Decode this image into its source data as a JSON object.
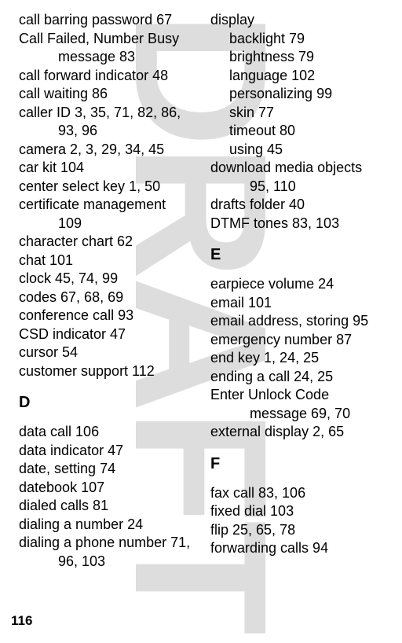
{
  "watermark": "DRAFT",
  "page_number": "116",
  "left_column": {
    "entries": [
      {
        "text": "call barring password  67",
        "indent": false
      },
      {
        "text": "Call Failed, Number Busy ",
        "indent": false
      },
      {
        "text": "message  83",
        "indent": true
      },
      {
        "text": "call forward indicator  48",
        "indent": false
      },
      {
        "text": "call waiting  86",
        "indent": false
      },
      {
        "text": "caller ID  3, 35, 71, 82, 86, ",
        "indent": false
      },
      {
        "text": "93, 96",
        "indent": true
      },
      {
        "text": "camera  2, 3, 29, 34, 45",
        "indent": false
      },
      {
        "text": "car kit  104",
        "indent": false
      },
      {
        "text": "center select key  1, 50",
        "indent": false
      },
      {
        "text": "certificate management  ",
        "indent": false
      },
      {
        "text": "109",
        "indent": true
      },
      {
        "text": "character chart  62",
        "indent": false
      },
      {
        "text": "chat  101",
        "indent": false
      },
      {
        "text": "clock  45, 74, 99",
        "indent": false
      },
      {
        "text": "codes  67, 68, 69",
        "indent": false
      },
      {
        "text": "conference call  93",
        "indent": false
      },
      {
        "text": "CSD indicator  47",
        "indent": false
      },
      {
        "text": "cursor  54",
        "indent": false
      },
      {
        "text": "customer support  112",
        "indent": false
      }
    ],
    "section_d": {
      "heading": "D",
      "entries": [
        {
          "text": "data call  106",
          "indent": false
        },
        {
          "text": "data indicator  47",
          "indent": false
        },
        {
          "text": "date, setting  74",
          "indent": false
        },
        {
          "text": "datebook  107",
          "indent": false
        },
        {
          "text": "dialed calls  81",
          "indent": false
        },
        {
          "text": "dialing a number  24",
          "indent": false
        },
        {
          "text": "dialing a phone number  71, ",
          "indent": false
        },
        {
          "text": "96, 103",
          "indent": true
        }
      ]
    }
  },
  "right_column": {
    "entries": [
      {
        "text": "display",
        "indent": false
      },
      {
        "text": "backlight  79",
        "indent": false,
        "sub": true
      },
      {
        "text": "brightness  79",
        "indent": false,
        "sub": true
      },
      {
        "text": "language  102",
        "indent": false,
        "sub": true
      },
      {
        "text": "personalizing  99",
        "indent": false,
        "sub": true
      },
      {
        "text": "skin  77",
        "indent": false,
        "sub": true
      },
      {
        "text": "timeout  80",
        "indent": false,
        "sub": true
      },
      {
        "text": "using  45",
        "indent": false,
        "sub": true
      },
      {
        "text": "download media objects  ",
        "indent": false
      },
      {
        "text": "95, 110",
        "indent": true
      },
      {
        "text": "drafts folder  40",
        "indent": false
      },
      {
        "text": "DTMF tones  83, 103",
        "indent": false
      }
    ],
    "section_e": {
      "heading": "E",
      "entries": [
        {
          "text": "earpiece volume  24",
          "indent": false
        },
        {
          "text": "email  101",
          "indent": false
        },
        {
          "text": "email address, storing  95",
          "indent": false
        },
        {
          "text": "emergency number  87",
          "indent": false
        },
        {
          "text": "end key  1, 24, 25",
          "indent": false
        },
        {
          "text": "ending a call  24, 25",
          "indent": false
        },
        {
          "text": "Enter Unlock Code ",
          "indent": false
        },
        {
          "text": "message  69, 70",
          "indent": true
        },
        {
          "text": "external display  2, 65",
          "indent": false
        }
      ]
    },
    "section_f": {
      "heading": "F",
      "entries": [
        {
          "text": "fax call  83, 106",
          "indent": false
        },
        {
          "text": "fixed dial  103",
          "indent": false
        },
        {
          "text": "flip  25, 65, 78",
          "indent": false
        },
        {
          "text": "forwarding calls  94",
          "indent": false
        }
      ]
    }
  }
}
